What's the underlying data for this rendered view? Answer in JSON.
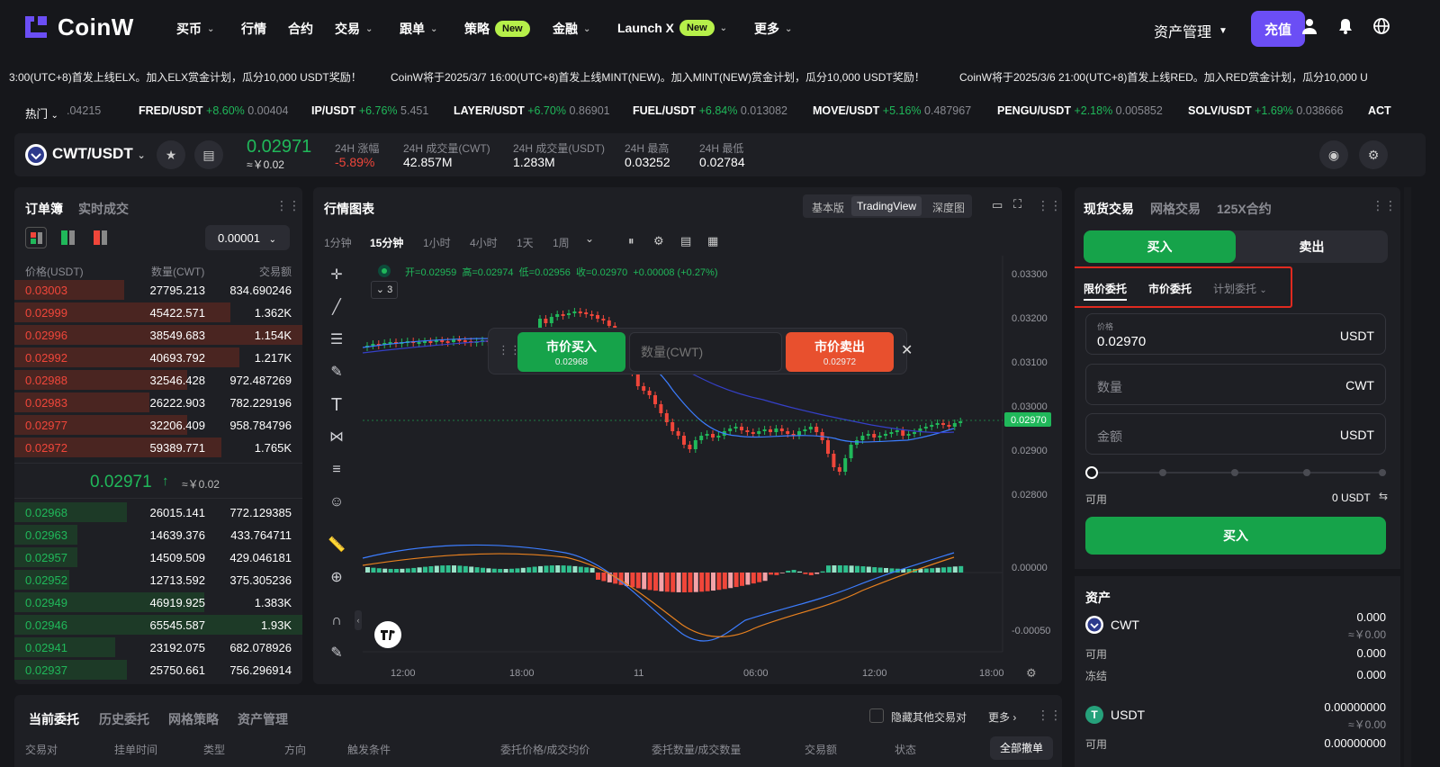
{
  "brand": {
    "name": "CoinW"
  },
  "nav": {
    "items": [
      {
        "label": "买币",
        "chev": true
      },
      {
        "label": "行情",
        "chev": false
      },
      {
        "label": "合约",
        "chev": false
      },
      {
        "label": "交易",
        "chev": true
      },
      {
        "label": "跟单",
        "chev": true
      },
      {
        "label": "策略",
        "chev": false,
        "badge": "New"
      },
      {
        "label": "金融",
        "chev": true
      },
      {
        "label": "Launch X",
        "chev": true,
        "badge": "New"
      },
      {
        "label": "更多",
        "chev": true
      }
    ],
    "asset_mgmt": "资产管理",
    "deposit": "充值"
  },
  "ticker": [
    "3:00(UTC+8)首发上线ELX。加入ELX赏金计划，瓜分10,000 USDT奖励！",
    "CoinW将于2025/3/7 16:00(UTC+8)首发上线MINT(NEW)。加入MINT(NEW)赏金计划，瓜分10,000 USDT奖励！",
    "CoinW将于2025/3/6 21:00(UTC+8)首发上线RED。加入RED赏金计划，瓜分10,000 U"
  ],
  "hot": {
    "label": "热门",
    "lead_price": ".04215",
    "items": [
      {
        "pair": "FRED/USDT",
        "change": "+8.60%",
        "price": "0.00404"
      },
      {
        "pair": "IP/USDT",
        "change": "+6.76%",
        "price": "5.451"
      },
      {
        "pair": "LAYER/USDT",
        "change": "+6.70%",
        "price": "0.86901"
      },
      {
        "pair": "FUEL/USDT",
        "change": "+6.84%",
        "price": "0.013082"
      },
      {
        "pair": "MOVE/USDT",
        "change": "+5.16%",
        "price": "0.487967"
      },
      {
        "pair": "PENGU/USDT",
        "change": "+2.18%",
        "price": "0.005852"
      },
      {
        "pair": "SOLV/USDT",
        "change": "+1.69%",
        "price": "0.038666"
      },
      {
        "pair": "ACT",
        "change": "",
        "price": ""
      }
    ]
  },
  "symbol": {
    "pair": "CWT/USDT",
    "price": "0.02971",
    "cny": "≈￥0.02",
    "stats": [
      {
        "label": "24H 涨幅",
        "value": "-5.89%"
      },
      {
        "label": "24H 成交量(CWT)",
        "value": "42.857M"
      },
      {
        "label": "24H 成交量(USDT)",
        "value": "1.283M"
      },
      {
        "label": "24H 最高",
        "value": "0.03252"
      },
      {
        "label": "24H 最低",
        "value": "0.02784"
      }
    ]
  },
  "orderbook": {
    "tab_active": "订单簿",
    "tab_other": "实时成交",
    "precision": "0.00001",
    "headers": [
      "价格(USDT)",
      "数量(CWT)",
      "交易额"
    ],
    "asks": [
      {
        "price": "0.03003",
        "qty": "27795.213",
        "total": "834.690246",
        "depth": 0.38
      },
      {
        "price": "0.02999",
        "qty": "45422.571",
        "total": "1.362K",
        "depth": 0.75
      },
      {
        "price": "0.02996",
        "qty": "38549.683",
        "total": "1.154K",
        "depth": 1.0
      },
      {
        "price": "0.02992",
        "qty": "40693.792",
        "total": "1.217K",
        "depth": 0.78
      },
      {
        "price": "0.02988",
        "qty": "32546.428",
        "total": "972.487269",
        "depth": 0.6
      },
      {
        "price": "0.02983",
        "qty": "26222.903",
        "total": "782.229196",
        "depth": 0.47
      },
      {
        "price": "0.02977",
        "qty": "32206.409",
        "total": "958.784796",
        "depth": 0.6
      },
      {
        "price": "0.02972",
        "qty": "59389.771",
        "total": "1.765K",
        "depth": 0.72
      }
    ],
    "last": "0.02971",
    "last_arrow": "↑",
    "last_cny": "≈￥0.02",
    "bids": [
      {
        "price": "0.02968",
        "qty": "26015.141",
        "total": "772.129385",
        "depth": 0.39
      },
      {
        "price": "0.02963",
        "qty": "14639.376",
        "total": "433.764711",
        "depth": 0.22
      },
      {
        "price": "0.02957",
        "qty": "14509.509",
        "total": "429.046181",
        "depth": 0.22
      },
      {
        "price": "0.02952",
        "qty": "12713.592",
        "total": "375.305236",
        "depth": 0.19
      },
      {
        "price": "0.02949",
        "qty": "46919.925",
        "total": "1.383K",
        "depth": 0.66
      },
      {
        "price": "0.02946",
        "qty": "65545.587",
        "total": "1.93K",
        "depth": 1.0
      },
      {
        "price": "0.02941",
        "qty": "23192.075",
        "total": "682.078926",
        "depth": 0.35
      },
      {
        "price": "0.02937",
        "qty": "25750.661",
        "total": "756.296914",
        "depth": 0.39
      }
    ]
  },
  "chart": {
    "title": "行情图表",
    "views": [
      "基本版",
      "TradingView",
      "深度图"
    ],
    "active_view": "TradingView",
    "intervals": [
      "1分钟",
      "15分钟",
      "1小时",
      "4小时",
      "1天",
      "1周"
    ],
    "active_interval": "15分钟",
    "ohlc": {
      "o_label": "开=",
      "o": "0.02959",
      "h_label": "高=",
      "h": "0.02974",
      "l_label": "低=",
      "l": "0.02956",
      "c_label": "收=",
      "c": "0.02970",
      "chg": "+0.00008 (+0.27%)"
    },
    "indicator_count": "3",
    "yticks": [
      "0.03300",
      "0.03200",
      "0.03100",
      "0.03000",
      "0.02900",
      "0.02800"
    ],
    "last_price_tag": "0.02970",
    "macd_ticks": [
      "0.00000",
      "-0.00050"
    ],
    "xticks": [
      "12:00",
      "18:00",
      "11",
      "06:00",
      "12:00",
      "18:00"
    ],
    "quick": {
      "buy_label": "市价买入",
      "buy_price": "0.02968",
      "qty_placeholder": "数量(CWT)",
      "sell_label": "市价卖出",
      "sell_price": "0.02972"
    }
  },
  "trade": {
    "tabs": [
      "现货交易",
      "网格交易",
      "125X合约"
    ],
    "buy": "买入",
    "sell": "卖出",
    "order_types": [
      "限价委托",
      "市价委托",
      "计划委托"
    ],
    "price_label": "价格",
    "price_value": "0.02970",
    "price_unit": "USDT",
    "qty_placeholder": "数量",
    "qty_unit": "CWT",
    "amount_placeholder": "金额",
    "amount_unit": "USDT",
    "avail_label": "可用",
    "avail_value": "0 USDT",
    "submit": "买入",
    "assets_title": "资产",
    "assets": [
      {
        "coin": "CWT",
        "amount": "0.000",
        "cny": "≈￥0.00",
        "avail_label": "可用",
        "avail": "0.000",
        "frozen_label": "冻结",
        "frozen": "0.000"
      },
      {
        "coin": "USDT",
        "amount": "0.00000000",
        "cny": "≈￥0.00",
        "avail_label": "可用",
        "avail": "0.00000000"
      }
    ]
  },
  "orders": {
    "tabs": [
      "当前委托",
      "历史委托",
      "网格策略",
      "资产管理"
    ],
    "hide_label": "隐藏其他交易对",
    "more": "更多",
    "columns": [
      "交易对",
      "挂单时间",
      "类型",
      "方向",
      "触发条件",
      "委托价格/成交均价",
      "委托数量/成交数量",
      "交易额",
      "状态"
    ],
    "cancel_all": "全部撤单"
  },
  "colors": {
    "up": "#20b85a",
    "down": "#f0463a",
    "accent": "#6b4ef5",
    "badge": "#b6f04a"
  }
}
